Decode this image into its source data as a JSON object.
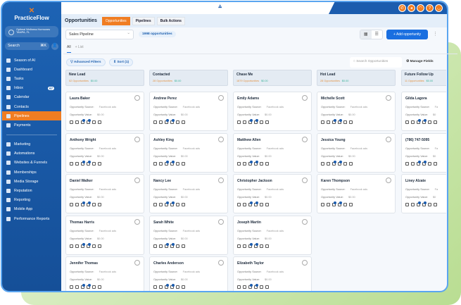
{
  "sidebar": {
    "brand": "PracticeFlow",
    "location_name": "Optimal Wellness Hormones",
    "location_city": "TAMPA, FL",
    "search": "Search",
    "search_shortcut": "⌘K",
    "items": [
      {
        "label": "Season of AI"
      },
      {
        "label": "Dashboard"
      },
      {
        "label": "Tasks"
      },
      {
        "label": "Inbox",
        "badge": "67"
      },
      {
        "label": "Calendar"
      },
      {
        "label": "Contacts"
      },
      {
        "label": "Pipelines",
        "active": true
      },
      {
        "label": "Payments"
      }
    ],
    "items2": [
      {
        "label": "Marketing"
      },
      {
        "label": "Automations"
      },
      {
        "label": "Websites & Funnels"
      },
      {
        "label": "Memberships"
      },
      {
        "label": "Media Storage"
      },
      {
        "label": "Reputation"
      },
      {
        "label": "Reporting"
      },
      {
        "label": "Mobile App"
      },
      {
        "label": "Performance Reports"
      }
    ]
  },
  "header": {
    "title": "Opportunities",
    "tabs": [
      "Opportunities",
      "Pipelines",
      "Bulk Actions"
    ]
  },
  "toolbar": {
    "pipeline": "Sales Pipeline",
    "count": "1998 opportunities",
    "add": "+ Add opportunity",
    "view_all": "All",
    "view_list": "+ List",
    "filters": "Advanced Filters",
    "sort": "Sort (1)",
    "search_placeholder": "Search Opportunities",
    "manage": "Manage Fields"
  },
  "labels": {
    "source": "Opportunity Source:",
    "value": "Opportunity Value:"
  },
  "colors": {
    "brand": "#1d63b4",
    "accent": "#f07d22",
    "primary_button": "#1a6fe0"
  },
  "columns": [
    {
      "name": "New Lead",
      "count": "52 Opportunities",
      "value": "$0.00",
      "cards": [
        {
          "name": "Laura Baker",
          "source": "Facebook ads",
          "value": "$0.00"
        },
        {
          "name": "Anthony Wright",
          "source": "Facebook ads",
          "value": "$0.00"
        },
        {
          "name": "Daniel Walker",
          "source": "Facebook ads",
          "value": "$0.00"
        },
        {
          "name": "Thomas Harris",
          "source": "Facebook ads",
          "value": "$0.00"
        },
        {
          "name": "Jennifer Thomas",
          "source": "Facebook ads",
          "value": "$0.00"
        }
      ]
    },
    {
      "name": "Contacted",
      "count": "28 Opportunities",
      "value": "$0.00",
      "cards": [
        {
          "name": "Andrew Perez",
          "source": "Facebook ads",
          "value": "$0.00"
        },
        {
          "name": "Ashley King",
          "source": "Facebook ads",
          "value": "$0.00"
        },
        {
          "name": "Nancy Lee",
          "source": "Facebook ads",
          "value": "$0.00"
        },
        {
          "name": "Sarah White",
          "source": "Facebook ads",
          "value": "$0.00"
        },
        {
          "name": "Charles Anderson",
          "source": "Facebook ads",
          "value": "$0.00"
        }
      ]
    },
    {
      "name": "Chase Me",
      "count": "1879 Opportunities",
      "value": "$0.00",
      "cards": [
        {
          "name": "Emily Adams",
          "source": "Facebook ads",
          "value": "$0.00"
        },
        {
          "name": "Matthew Allen",
          "source": "Facebook ads",
          "value": "$0.00"
        },
        {
          "name": "Christopher Jackson",
          "source": "Facebook ads",
          "value": "$0.00"
        },
        {
          "name": "Joseph Martin",
          "source": "Facebook ads",
          "value": "$0.00"
        },
        {
          "name": "Elizabeth Taylor",
          "source": "Facebook ads",
          "value": "$0.00"
        }
      ]
    },
    {
      "name": "Hot Lead",
      "count": "28 Opportunities",
      "value": "$0.00",
      "cards": [
        {
          "name": "Michelle Scott",
          "source": "Facebook ads",
          "value": "$0.00"
        },
        {
          "name": "Jessica Young",
          "source": "Facebook ads",
          "value": "$0.00"
        },
        {
          "name": "Karen Thompson",
          "source": "Facebook ads",
          "value": "$0.00"
        }
      ]
    },
    {
      "name": "Future Follow Up",
      "count": "11 Opportunities",
      "value": "$0.00",
      "cards": [
        {
          "name": "Gilda Lagora",
          "source": "Fa",
          "value": "$0"
        },
        {
          "name": "(786) 747-5095",
          "source": "Fa",
          "value": "$0"
        },
        {
          "name": "Liney Alzate",
          "source": "Fa",
          "value": "$0"
        }
      ]
    }
  ]
}
